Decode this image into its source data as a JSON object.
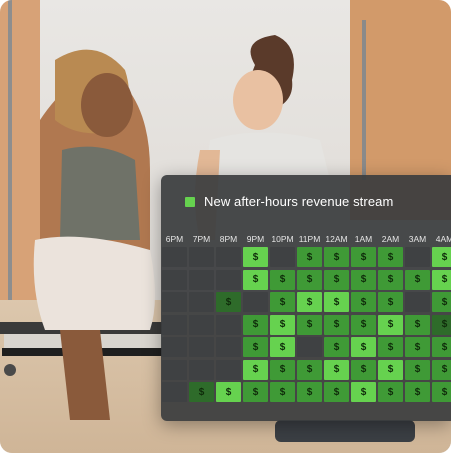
{
  "legend": {
    "label": "New after-hours revenue stream",
    "swatch_color": "#66d24f"
  },
  "hours": [
    "6PM",
    "7PM",
    "8PM",
    "9PM",
    "10PM",
    "11PM",
    "12AM",
    "1AM",
    "2AM",
    "3AM",
    "4AM"
  ],
  "cell_symbol": "$",
  "level_colors": {
    "0": "#3f4143",
    "1": "#2e6b2a",
    "2": "#3f9a36",
    "3": "#66d24f"
  },
  "grid_levels": [
    [
      0,
      0,
      0,
      3,
      0,
      2,
      2,
      2,
      2,
      0,
      3
    ],
    [
      0,
      0,
      0,
      3,
      2,
      2,
      2,
      2,
      2,
      2,
      3
    ],
    [
      0,
      0,
      1,
      0,
      2,
      3,
      3,
      2,
      2,
      0,
      2
    ],
    [
      0,
      0,
      0,
      2,
      3,
      2,
      2,
      2,
      3,
      2,
      1
    ],
    [
      0,
      0,
      0,
      2,
      3,
      0,
      2,
      3,
      2,
      2,
      2
    ],
    [
      0,
      0,
      0,
      3,
      2,
      2,
      3,
      2,
      3,
      2,
      2
    ],
    [
      0,
      1,
      3,
      2,
      2,
      2,
      2,
      3,
      2,
      2,
      2
    ]
  ]
}
